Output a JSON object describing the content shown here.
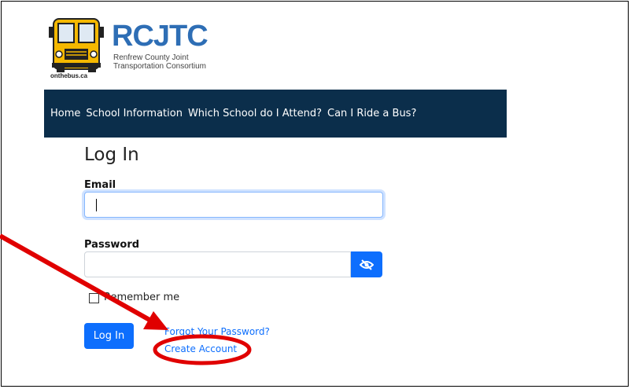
{
  "logo": {
    "brand": "RCJTC",
    "subtitle_line1": "Renfrew County Joint",
    "subtitle_line2": "Transportation Consortium",
    "tagline": "onthebus.ca"
  },
  "nav": {
    "items": [
      {
        "label": "Home"
      },
      {
        "label": "School Information"
      },
      {
        "label": "Which School do I Attend?"
      },
      {
        "label": "Can I Ride a Bus?"
      }
    ]
  },
  "form": {
    "title": "Log In",
    "email_label": "Email",
    "email_value": "",
    "password_label": "Password",
    "password_value": "",
    "remember_label": "Remember me",
    "login_button": "Log In",
    "forgot_link": "Forgot Your Password?",
    "create_link": "Create Account"
  },
  "colors": {
    "nav_bg": "#0b2e4b",
    "primary": "#0d6efd",
    "brand": "#2e6eb5",
    "annotation": "#e00000"
  },
  "icons": [
    "school-bus-icon",
    "eye-slash-icon",
    "annotation-arrow",
    "annotation-ellipse"
  ]
}
